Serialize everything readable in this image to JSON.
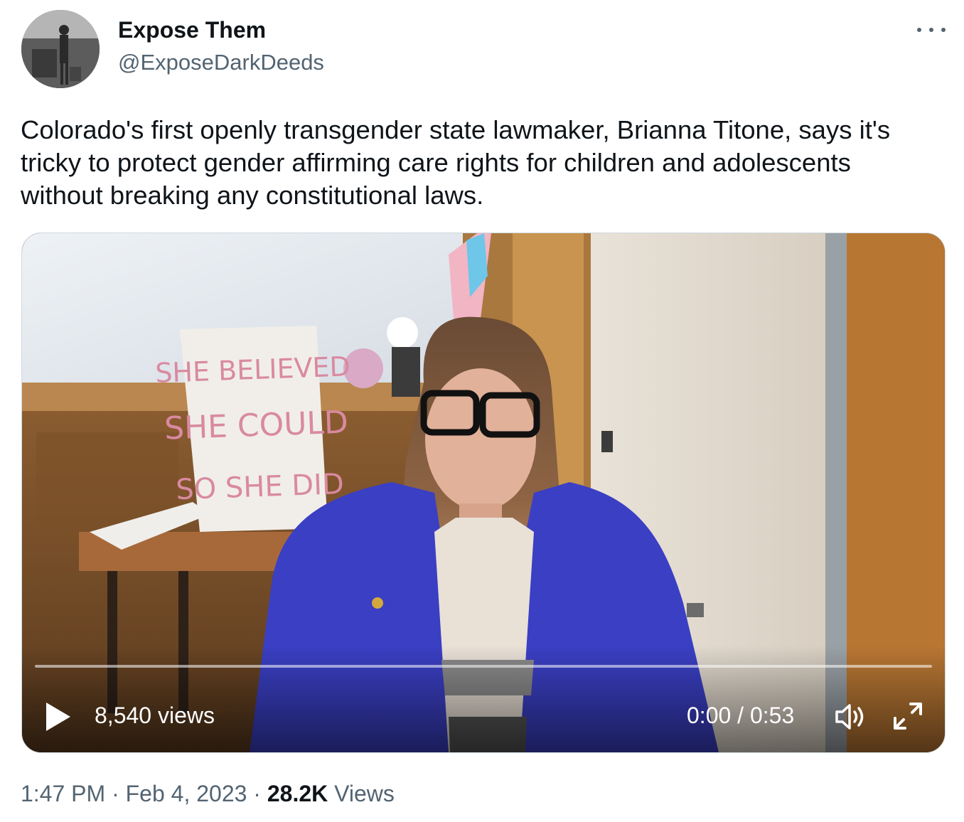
{
  "author": {
    "name": "Expose Them",
    "handle": "@ExposeDarkDeeds"
  },
  "tweet": {
    "text": "Colorado's first openly transgender state lawmaker, Brianna Titone, says it's tricky to protect gender affirming care rights for children and adolescents without breaking any constitutional laws."
  },
  "video": {
    "sign_text": [
      "SHE BELIEVED",
      "SHE COULD",
      "SO SHE DID"
    ],
    "views": "8,540 views",
    "time": "0:00 / 0:53",
    "progress": 0,
    "icons": {
      "play": "play-icon",
      "volume": "volume-icon",
      "fullscreen": "fullscreen-icon"
    }
  },
  "meta": {
    "time": "1:47 PM",
    "sep1": " · ",
    "date": "Feb 4, 2023",
    "sep2": " · ",
    "views_count": "28.2K",
    "views_label": " Views"
  },
  "colors": {
    "text": "#0f1419",
    "secondary": "#536471",
    "blazer": "#3a3fc4",
    "sign_text": "#d98aa0"
  }
}
